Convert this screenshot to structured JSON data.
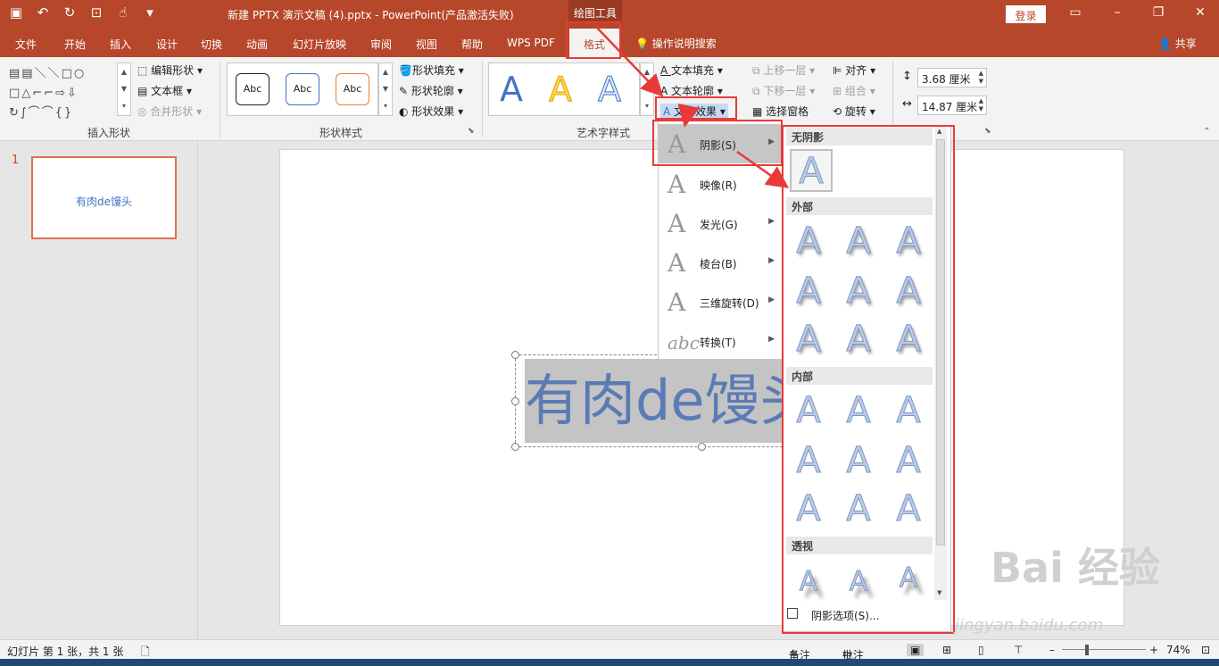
{
  "app": {
    "doc_title": "新建 PPTX 演示文稿 (4).pptx  -  PowerPoint(产品激活失败)",
    "drawing_tools": "绘图工具",
    "login": "登录",
    "share": "共享",
    "search": "操作说明搜索"
  },
  "tabs": [
    "文件",
    "开始",
    "插入",
    "设计",
    "切换",
    "动画",
    "幻灯片放映",
    "审阅",
    "视图",
    "帮助",
    "WPS PDF"
  ],
  "active_tab": "格式",
  "ribbon": {
    "insert_shapes": {
      "label": "插入形状",
      "edit_shape": "编辑形状",
      "text_box": "文本框",
      "merge_shapes": "合并形状"
    },
    "shape_styles": {
      "label": "形状样式",
      "samples": [
        "Abc",
        "Abc",
        "Abc"
      ],
      "fill": "形状填充",
      "outline": "形状轮廓",
      "effects": "形状效果"
    },
    "wordart": {
      "label": "艺术字样式",
      "text_fill": "文本填充",
      "text_outline": "文本轮廓",
      "text_effects": "文本效果",
      "letter": "A"
    },
    "arrange": {
      "bring_forward": "上移一层",
      "send_backward": "下移一层",
      "selection_pane": "选择窗格",
      "align": "对齐",
      "group": "组合",
      "rotate": "旋转"
    },
    "size": {
      "height": "3.68 厘米",
      "width": "14.87 厘米"
    }
  },
  "slides_pane": {
    "number": "1",
    "thumb_text": "有肉de馒头"
  },
  "slide": {
    "text": "有肉de馒头"
  },
  "effects_menu": [
    {
      "label": "阴影(S)",
      "glyph": "A"
    },
    {
      "label": "映像(R)",
      "glyph": "A"
    },
    {
      "label": "发光(G)",
      "glyph": "A"
    },
    {
      "label": "棱台(B)",
      "glyph": "A"
    },
    {
      "label": "三维旋转(D)",
      "glyph": "A"
    },
    {
      "label": "转换(T)",
      "glyph": "abc"
    }
  ],
  "shadow_gallery": {
    "none_header": "无阴影",
    "outer_header": "外部",
    "inner_header": "内部",
    "perspective_header": "透视",
    "glyph": "A",
    "options": "阴影选项(S)..."
  },
  "status": {
    "slide_info": "幻灯片 第 1 张，共 1 张",
    "notes": "备注",
    "comments": "批注",
    "zoom": "74%"
  },
  "watermark": {
    "brand": "Bai  经验",
    "url": "jingyan.baidu.com"
  }
}
